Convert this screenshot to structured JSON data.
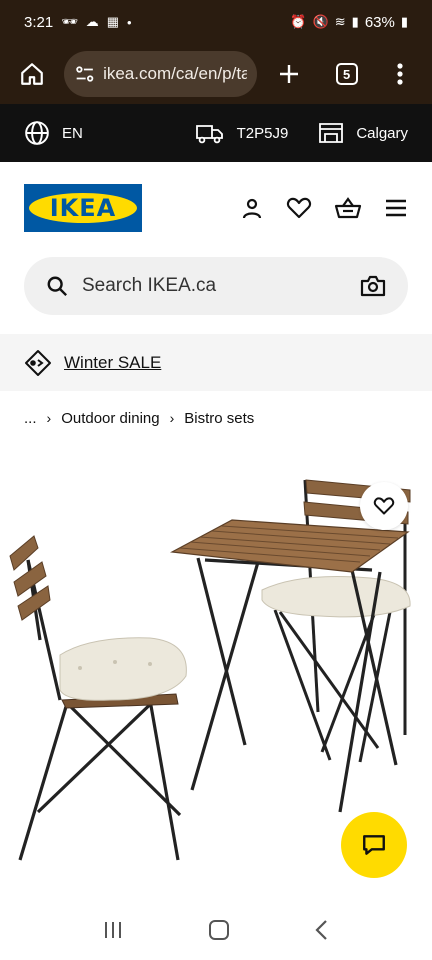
{
  "status": {
    "time": "3:21",
    "battery": "63%"
  },
  "browser": {
    "url": "ikea.com/ca/en/p/ta",
    "tab_count": "5"
  },
  "topstrip": {
    "language": "EN",
    "postal_code": "T2P5J9",
    "store": "Calgary"
  },
  "header": {
    "logo_text": "IKEA"
  },
  "search": {
    "placeholder": "Search IKEA.ca"
  },
  "promo": {
    "label": "Winter SALE"
  },
  "breadcrumb": {
    "items": [
      "...",
      "Outdoor dining",
      "Bistro sets"
    ]
  },
  "colors": {
    "brand_blue": "#0058a3",
    "brand_yellow": "#ffdb00",
    "browser_bg": "#2a1c10"
  },
  "icons": [
    "home-icon",
    "url-settings-icon",
    "plus-icon",
    "tabs-icon",
    "more-icon",
    "globe-icon",
    "truck-icon",
    "store-icon",
    "user-icon",
    "heart-icon",
    "basket-icon",
    "menu-icon",
    "search-icon",
    "camera-icon",
    "tag-icon",
    "chat-icon"
  ]
}
